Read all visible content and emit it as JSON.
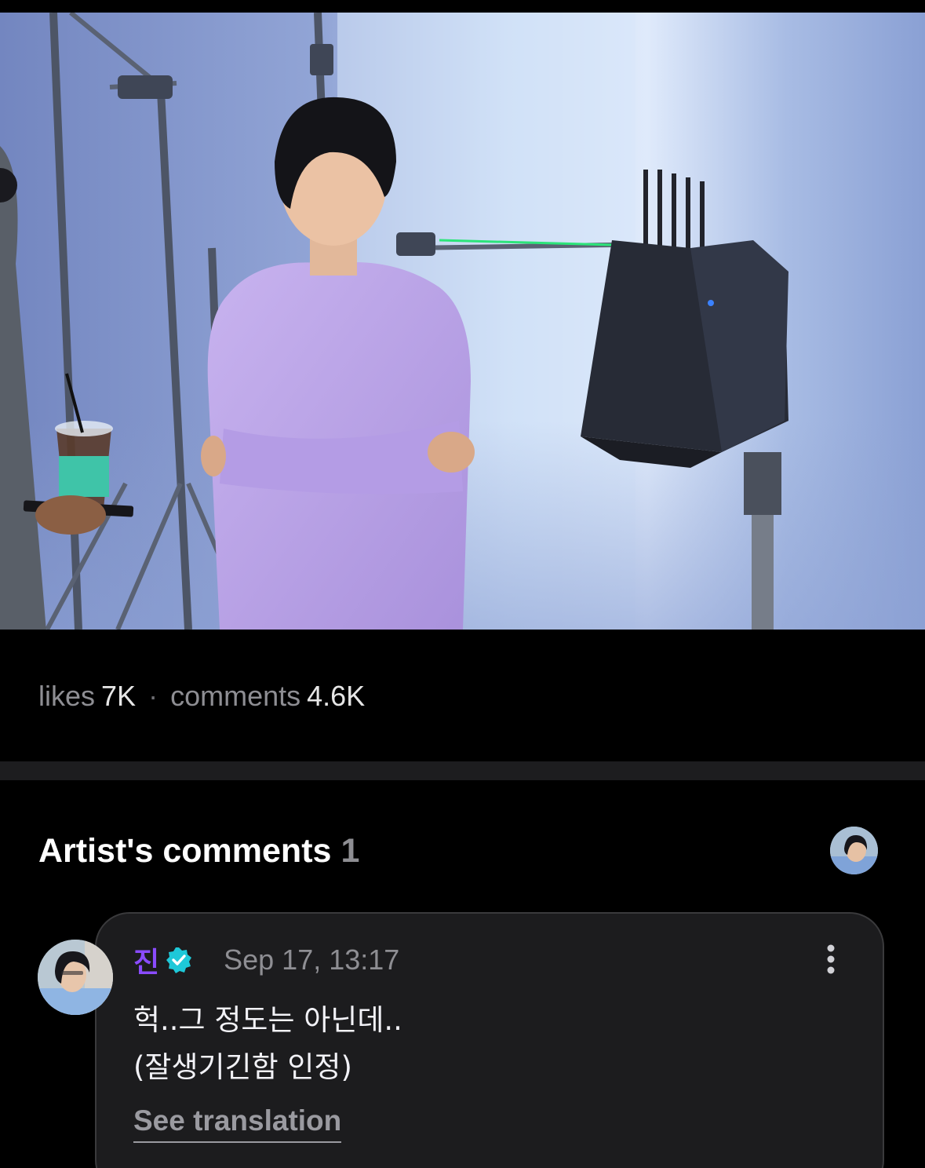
{
  "post": {
    "image": {
      "description_icon": "photo"
    },
    "stats": {
      "likes_label": "likes",
      "likes_value": "7K",
      "separator": "·",
      "comments_label": "comments",
      "comments_value": "4.6K"
    }
  },
  "artist_comments": {
    "title": "Artist's comments",
    "count": "1",
    "items": [
      {
        "author": "진",
        "verified": true,
        "timestamp": "Sep 17, 13:17",
        "lines": [
          "헉..그 정도는 아닌데..",
          "(잘생기긴함 인정)"
        ],
        "translate_label": "See translation"
      }
    ]
  },
  "colors": {
    "background": "#000000",
    "author_name": "#8a4bff",
    "verified_badge": "#1ec8d8",
    "muted_text": "#8e8e93",
    "card_background": "#1c1c1e"
  }
}
